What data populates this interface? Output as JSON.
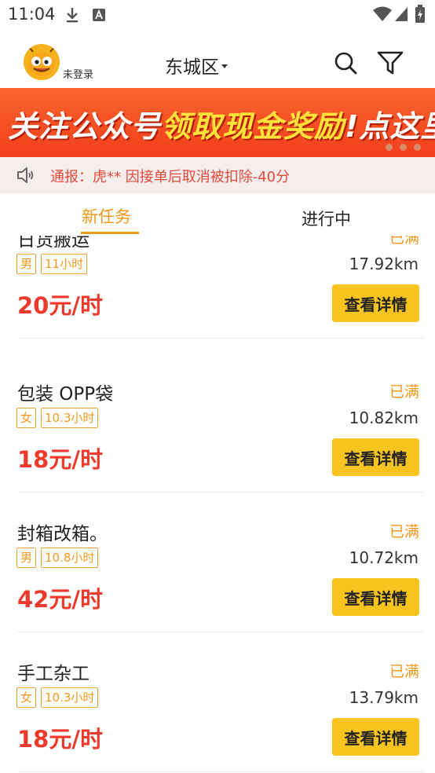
{
  "status_bar": {
    "time": "11:04"
  },
  "header": {
    "login_status": "未登录",
    "city": "东城区"
  },
  "banner": {
    "text_part1": "关注公众号",
    "text_highlight": "领取现金奖励",
    "text_part2": "!点这里!"
  },
  "notice": {
    "text": "通报：虎**    因接单后取消被扣除-40分"
  },
  "tabs": [
    {
      "label": "新任务",
      "active": true
    },
    {
      "label": "进行中",
      "active": false
    }
  ],
  "colors": {
    "accent": "#f5981b",
    "price": "#ee3a2c",
    "button": "#f7c31f",
    "banner": "#f23e1c",
    "notice": "#e2493a"
  },
  "jobs": [
    {
      "title": "日货搬运",
      "status": "已满",
      "gender": "男",
      "hours": "11小时",
      "distance": "17.92km",
      "price": "20元/时",
      "button": "查看详情"
    },
    {
      "title": "包装 OPP袋",
      "status": "已满",
      "gender": "女",
      "hours": "10.3小时",
      "distance": "10.82km",
      "price": "18元/时",
      "button": "查看详情"
    },
    {
      "title": "封箱改箱。",
      "status": "已满",
      "gender": "男",
      "hours": "10.8小时",
      "distance": "10.72km",
      "price": "42元/时",
      "button": "查看详情"
    },
    {
      "title": "手工杂工",
      "status": "已满",
      "gender": "女",
      "hours": "10.3小时",
      "distance": "13.79km",
      "price": "18元/时",
      "button": "查看详情"
    }
  ]
}
